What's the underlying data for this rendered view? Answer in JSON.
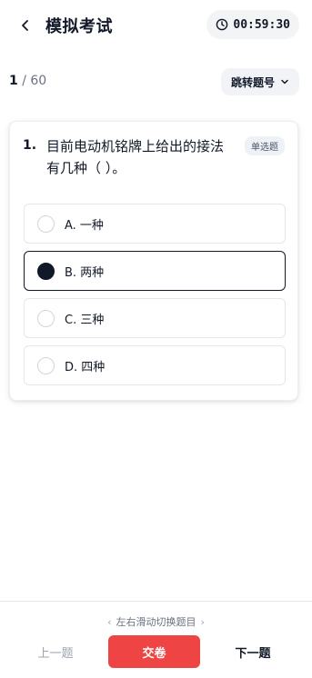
{
  "header": {
    "back_icon": "chevron-left-icon",
    "title": "模拟考试",
    "timer_icon": "clock-icon",
    "timer": "00:59:30"
  },
  "progress": {
    "current": "1",
    "separator": " / ",
    "total": "60"
  },
  "jump": {
    "label": "跳转题号",
    "icon": "chevron-down-icon"
  },
  "question": {
    "number": "1.",
    "text": "目前电动机铭牌上给出的接法有几种（ ）。",
    "type": "单选题",
    "options": [
      {
        "label": "A. 一种",
        "selected": false
      },
      {
        "label": "B. 两种",
        "selected": true
      },
      {
        "label": "C. 三种",
        "selected": false
      },
      {
        "label": "D. 四种",
        "selected": false
      }
    ]
  },
  "footer": {
    "hint": "左右滑动切换题目",
    "prev": "上一题",
    "submit": "交卷",
    "next": "下一题"
  },
  "colors": {
    "accent": "#111827",
    "submit": "#ef4444"
  }
}
